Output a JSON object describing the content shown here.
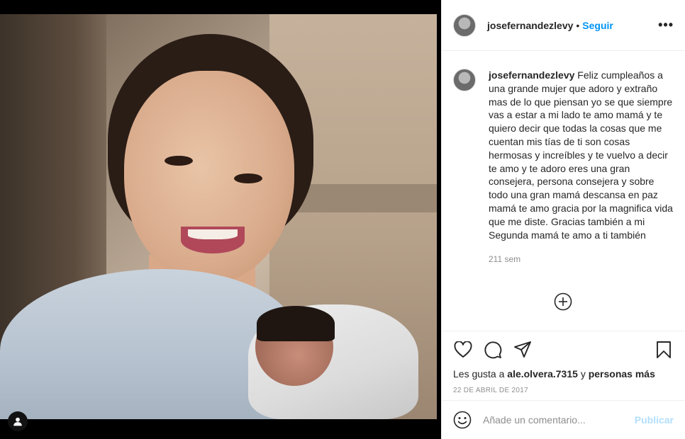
{
  "post": {
    "username": "josefernandezlevy",
    "follow_separator": "•",
    "follow_label": "Seguir",
    "more_label": "•••"
  },
  "caption": {
    "username": "josefernandezlevy",
    "text": "Feliz cumpleaños a una grande mujer que adoro y extraño mas de lo que piensan yo se que siempre vas a estar a mi lado te amo mamá y te quiero decir que todas la cosas que me cuentan mis tías de ti son cosas hermosas y increíbles y te vuelvo a decir te amo y te adoro eres una gran consejera, persona consejera y sobre todo una gran mamá descansa en paz mamá te amo gracia por la magnifica vida que me diste. Gracias también a mi Segunda mamá te amo a ti también",
    "time": "211 sem"
  },
  "likes": {
    "prefix": "Les gusta a",
    "user": "ale.olvera.7315",
    "middle": "y",
    "others": "personas más"
  },
  "date": "22 DE ABRIL DE 2017",
  "comment_box": {
    "placeholder": "Añade un comentario...",
    "publish_label": "Publicar"
  },
  "icons": {
    "like": "heart-icon",
    "comment": "comment-icon",
    "share": "share-icon",
    "save": "bookmark-icon",
    "more": "plus-circle-icon",
    "emoji": "emoji-icon",
    "tag": "user-tag-icon"
  },
  "colors": {
    "accent": "#0095f6",
    "publish_disabled": "#b2dffc",
    "secondary_text": "#8e8e8e"
  }
}
